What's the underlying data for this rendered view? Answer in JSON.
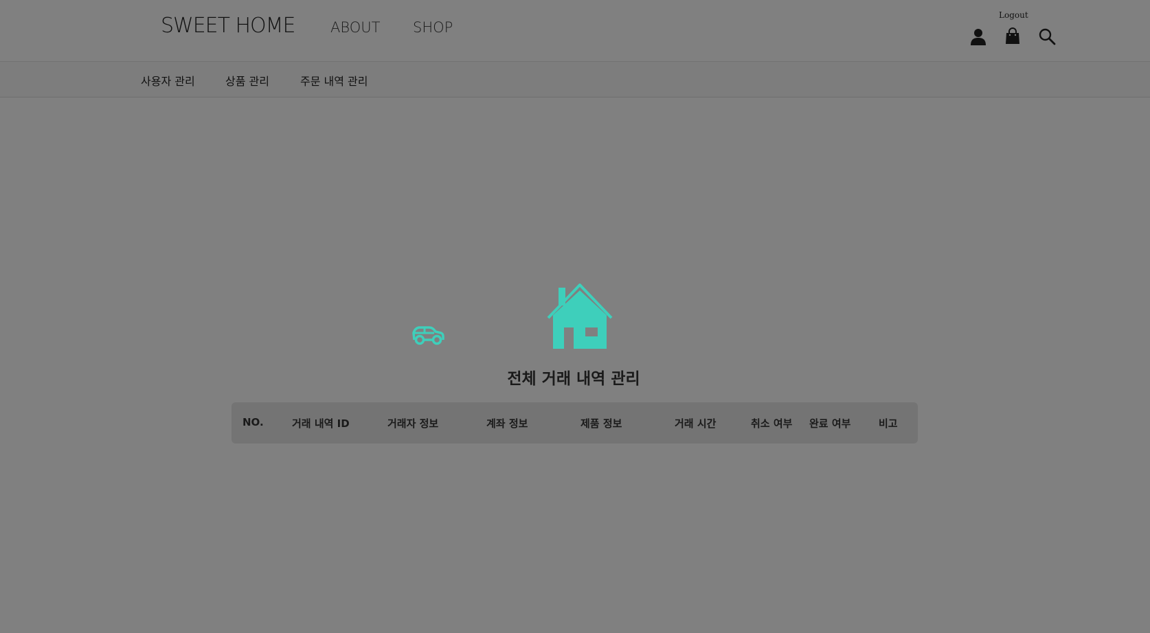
{
  "header": {
    "logo": "SWEET HOME",
    "nav": {
      "about": "ABOUT",
      "shop": "SHOP"
    },
    "logout": "Logout",
    "icons": [
      "user-icon",
      "bag-icon",
      "search-icon"
    ]
  },
  "admin_nav": {
    "items": [
      {
        "label": "사용자 관리"
      },
      {
        "label": "상품 관리"
      },
      {
        "label": "주문 내역 관리"
      }
    ]
  },
  "main": {
    "title": "전체 거래 내역 관리",
    "accent_color": "#3ecfbb",
    "table": {
      "columns": [
        "NO.",
        "거래 내역 ID",
        "거래자 정보",
        "계좌 정보",
        "제품 정보",
        "거래 시간",
        "취소 여부",
        "완료 여부",
        "비고"
      ],
      "rows": []
    }
  }
}
